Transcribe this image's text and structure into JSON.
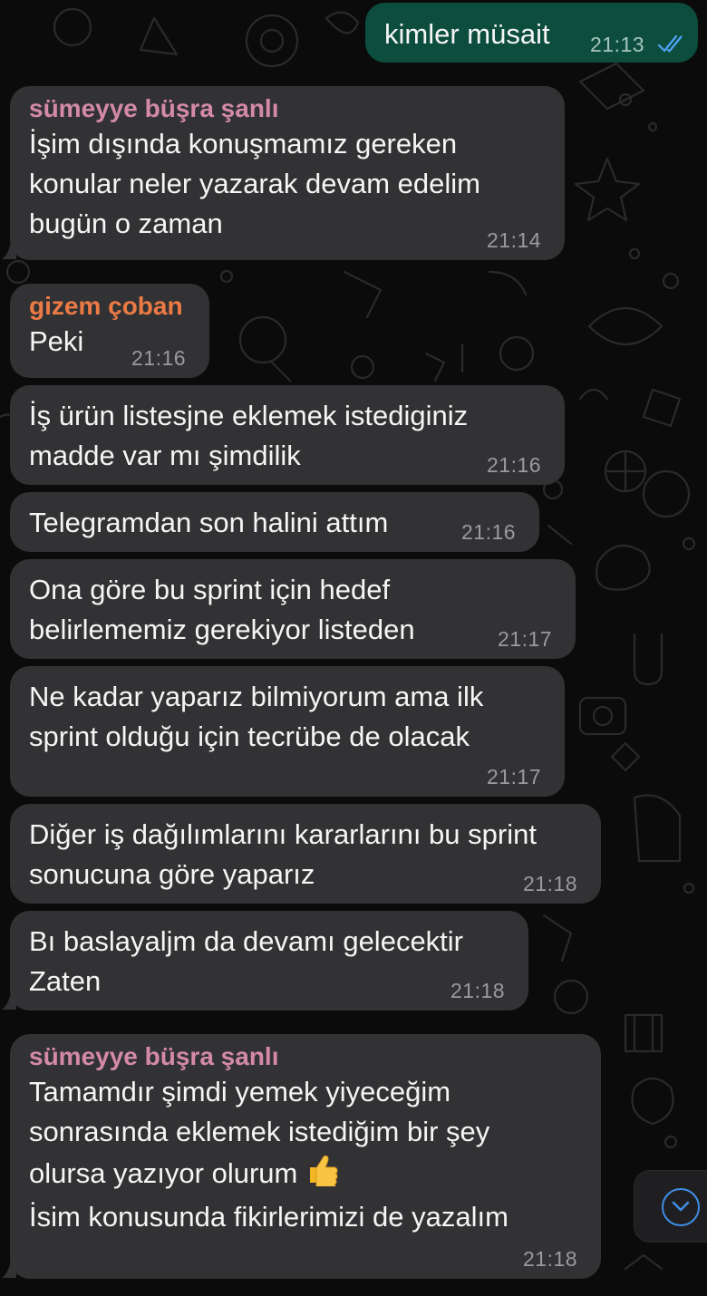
{
  "colors": {
    "background": "#0b0b0b",
    "incoming_bubble": "#323234",
    "outgoing_bubble": "#0d4d3e",
    "timestamp": "#9a9a9f",
    "read_ticks": "#4fa3f7",
    "sender_sumeyye": "#d48aa6",
    "sender_gizem": "#ec7a45",
    "scroll_button_accent": "#3f8ee6"
  },
  "messages": [
    {
      "direction": "outgoing",
      "text": "kimler müsait",
      "time": "21:13",
      "status_icon": "double-check-read-icon"
    },
    {
      "direction": "incoming",
      "sender": "sümeyye büşra şanlı",
      "text": "İşim dışında konuşmamız gereken\nkonular neler yazarak devam edelim\nbugün o zaman",
      "time": "21:14"
    },
    {
      "direction": "incoming",
      "sender": "gizem çoban",
      "text": "Peki",
      "time": "21:16"
    },
    {
      "direction": "incoming",
      "text": "İş ürün listesjne eklemek istediginiz\nmadde var mı şimdilik",
      "time": "21:16"
    },
    {
      "direction": "incoming",
      "text": "Telegramdan son halini attım",
      "time": "21:16"
    },
    {
      "direction": "incoming",
      "text": "Ona göre bu sprint için hedef\nbelirlememiz gerekiyor listeden",
      "time": "21:17"
    },
    {
      "direction": "incoming",
      "text": "Ne kadar yaparız bilmiyorum ama ilk\nsprint olduğu için tecrübe de olacak",
      "time": "21:17"
    },
    {
      "direction": "incoming",
      "text": "Diğer iş dağılımlarını kararlarını bu sprint\nsonucuna göre yaparız",
      "time": "21:18"
    },
    {
      "direction": "incoming",
      "text": "Bı baslayaljm da devamı gelecektir\nZaten",
      "time": "21:18"
    },
    {
      "direction": "incoming",
      "sender": "sümeyye büşra şanlı",
      "text_before_emoji": "Tamamdır şimdi yemek yiyeceğim\nsonrasında eklemek istediğim bir şey\nolursa yazıyor olurum",
      "emoji": "thumbs-up-icon",
      "text_after_emoji": "İsim konusunda fikirlerimizi de yazalım",
      "time": "21:18"
    }
  ],
  "scroll_button": {
    "icon": "chevron-down-circle-icon"
  }
}
